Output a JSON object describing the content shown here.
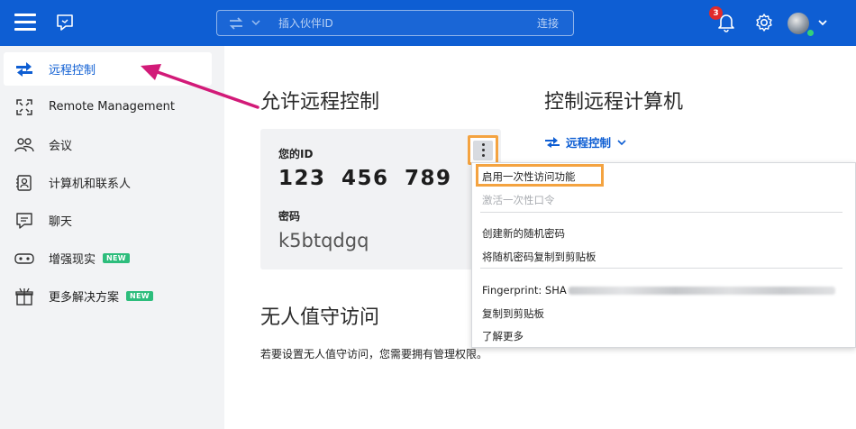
{
  "header": {
    "search_placeholder": "插入伙伴ID",
    "connect_label": "连接",
    "notification_count": "3",
    "icons": [
      "hamburger-icon",
      "chat-icon",
      "swap-arrows-icon",
      "bell-icon",
      "gear-icon",
      "chevron-down-icon"
    ]
  },
  "sidebar": {
    "items": [
      {
        "label": "远程控制",
        "icon": "swap-arrows-icon",
        "active": true
      },
      {
        "label": "Remote Management",
        "icon": "expand-icon"
      },
      {
        "label": "会议",
        "icon": "people-icon"
      },
      {
        "label": "计算机和联系人",
        "icon": "contact-card-icon"
      },
      {
        "label": "聊天",
        "icon": "chat-icon"
      },
      {
        "label": "增强现实",
        "icon": "ar-glasses-icon",
        "badge": "NEW"
      },
      {
        "label": "更多解决方案",
        "icon": "gift-icon",
        "badge": "NEW"
      }
    ]
  },
  "main": {
    "allow_title": "允许远程控制",
    "control_title": "控制远程计算机",
    "id_label": "您的ID",
    "id_value": "123 456 789",
    "password_label": "密码",
    "password_value": "k5btqdgq",
    "control_mode": "远程控制",
    "unattended_title": "无人值守访问",
    "unattended_text": "若要设置无人值守访问，您需要拥有管理权限。"
  },
  "menu": {
    "enable_one_time": "启用一次性访问功能",
    "activate_one_time": "激活一次性口令",
    "create_random_password": "创建新的随机密码",
    "copy_random_password": "将随机密码复制到剪贴板",
    "fingerprint": "Fingerprint: SHA",
    "copy_to_clipboard": "复制到剪贴板",
    "learn_more": "了解更多"
  },
  "colors": {
    "brand_blue": "#0e5ed3",
    "highlight_orange": "#f4a340",
    "arrow_magenta": "#d21a78",
    "new_badge_green": "#2dbd7c"
  }
}
